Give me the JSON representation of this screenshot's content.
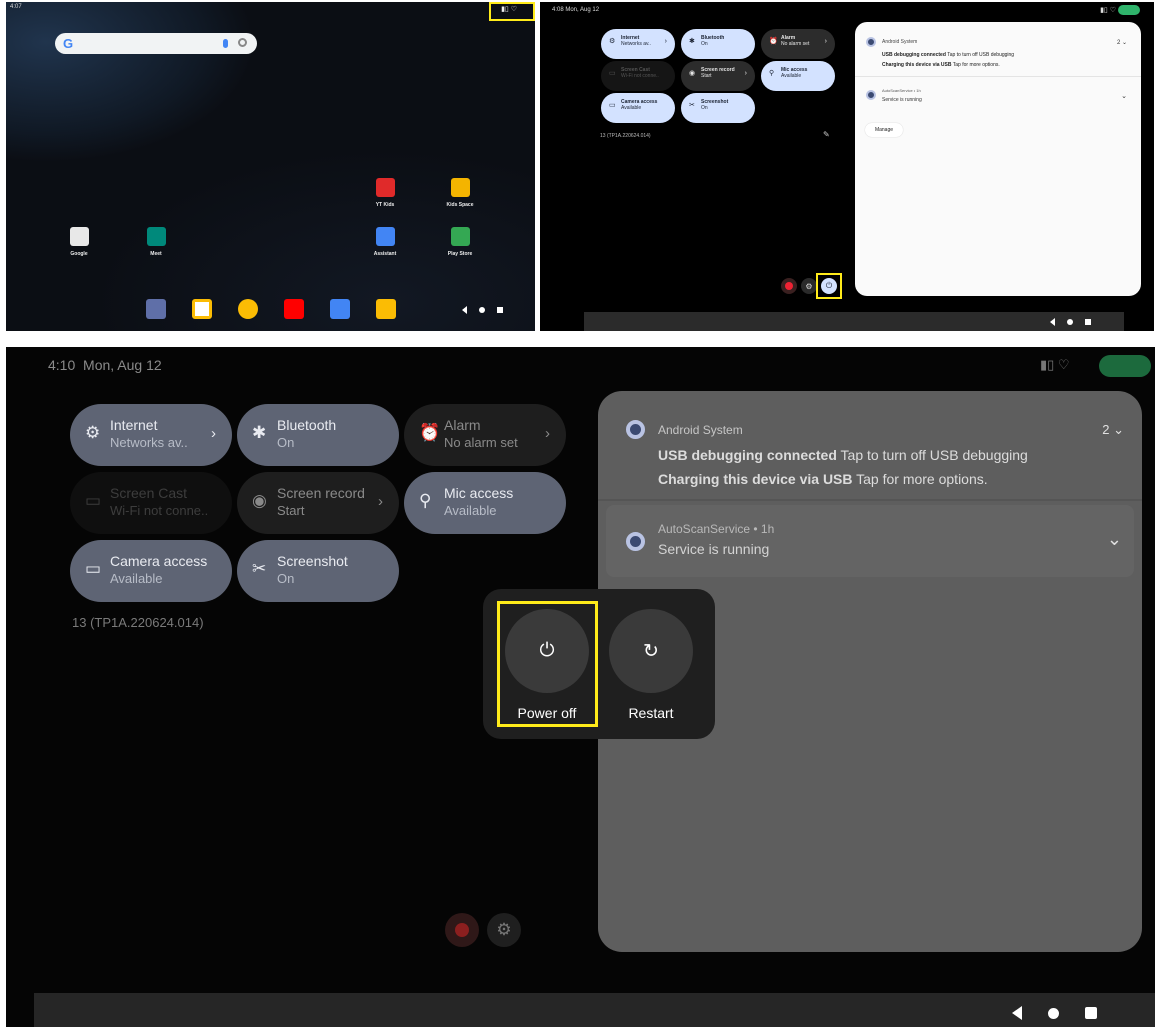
{
  "panel1": {
    "status_time": "4:07",
    "status_icons": "▮▯ ♡",
    "search": {
      "logo": "G"
    },
    "apps": [
      {
        "label": "YT Kids",
        "icon": "yt-kids-icon",
        "color": "#e02a2a"
      },
      {
        "label": "Kids Space",
        "icon": "kids-space-icon",
        "color": "#f4b400"
      },
      {
        "label": "Google",
        "icon": "google-folder-icon",
        "color": "#e8e8e8"
      },
      {
        "label": "Meet",
        "icon": "meet-icon",
        "color": "#00897b"
      },
      {
        "label": "Assistant",
        "icon": "assistant-icon",
        "color": "#4285f4"
      },
      {
        "label": "Play Store",
        "icon": "play-store-icon",
        "color": "#34a853"
      }
    ],
    "dock": [
      {
        "icon": "settings-icon",
        "color": "#5f6fa8"
      },
      {
        "icon": "gmail-icon",
        "color": "#ffffff"
      },
      {
        "icon": "chrome-icon",
        "color": "#fbbc04"
      },
      {
        "icon": "youtube-icon",
        "color": "#ff0000"
      },
      {
        "icon": "calendar-icon",
        "color": "#4285f4"
      },
      {
        "icon": "photos-icon",
        "color": "#fbbc04"
      }
    ]
  },
  "panel2": {
    "status": "4:08   Mon, Aug 12",
    "tiles": [
      {
        "title": "Internet",
        "sub": "Networks av..",
        "state": "on",
        "icon": "⚙",
        "chev": "›"
      },
      {
        "title": "Bluetooth",
        "sub": "On",
        "state": "on",
        "icon": "✱",
        "chev": ""
      },
      {
        "title": "Alarm",
        "sub": "No alarm set",
        "state": "off",
        "icon": "⏰",
        "chev": "›"
      },
      {
        "title": "Screen Cast",
        "sub": "Wi-Fi not conne..",
        "state": "dis",
        "icon": "▭",
        "chev": ""
      },
      {
        "title": "Screen record",
        "sub": "Start",
        "state": "off",
        "icon": "◉",
        "chev": "›"
      },
      {
        "title": "Mic access",
        "sub": "Available",
        "state": "on",
        "icon": "⚲",
        "chev": ""
      },
      {
        "title": "Camera access",
        "sub": "Available",
        "state": "on",
        "icon": "▭",
        "chev": ""
      },
      {
        "title": "Screenshot",
        "sub": "On",
        "state": "on",
        "icon": "✂",
        "chev": ""
      }
    ],
    "build": "13 (TP1A.220624.014)",
    "notif": {
      "app": "Android System",
      "count": "2 ⌄",
      "usb_bold": "USB debugging connected",
      "usb_rest": " Tap to turn off USB debugging",
      "chg_bold": "Charging this device via USB",
      "chg_rest": " Tap for more options.",
      "auto": "AutoScanService • 1h",
      "running": "Service is running",
      "manage": "Manage"
    }
  },
  "panel3": {
    "time": "4:10",
    "date": "Mon, Aug 12",
    "tiles": [
      {
        "title": "Internet",
        "sub": "Networks av..",
        "state": "on",
        "icon": "⚙",
        "chev": "›"
      },
      {
        "title": "Bluetooth",
        "sub": "On",
        "state": "on",
        "icon": "✱",
        "chev": ""
      },
      {
        "title": "Alarm",
        "sub": "No alarm set",
        "state": "off",
        "icon": "⏰",
        "chev": "›"
      },
      {
        "title": "Screen Cast",
        "sub": "Wi-Fi not conne..",
        "state": "dis",
        "icon": "▭",
        "chev": ""
      },
      {
        "title": "Screen record",
        "sub": "Start",
        "state": "off",
        "icon": "◉",
        "chev": "›"
      },
      {
        "title": "Mic access",
        "sub": "Available",
        "state": "on",
        "icon": "⚲",
        "chev": ""
      },
      {
        "title": "Camera access",
        "sub": "Available",
        "state": "on",
        "icon": "▭",
        "chev": ""
      },
      {
        "title": "Screenshot",
        "sub": "On",
        "state": "on",
        "icon": "✂",
        "chev": ""
      }
    ],
    "build": "13 (TP1A.220624.014)",
    "notif": {
      "app": "Android System",
      "count": "2 ⌄",
      "usb_bold": "USB debugging connected",
      "usb_rest": " Tap to turn off USB debugging",
      "chg_bold": "Charging this device via USB",
      "chg_rest": " Tap for more options.",
      "auto": "AutoScanService • 1h",
      "running": "Service is running"
    },
    "power": {
      "power_off": "Power off",
      "restart": "Restart",
      "power_glyph": "⏻",
      "restart_glyph": "↻"
    }
  },
  "colors": {
    "highlight": "#ffeb1a",
    "battery": "#2fb36b",
    "tile_on": "#d3e2ff"
  }
}
